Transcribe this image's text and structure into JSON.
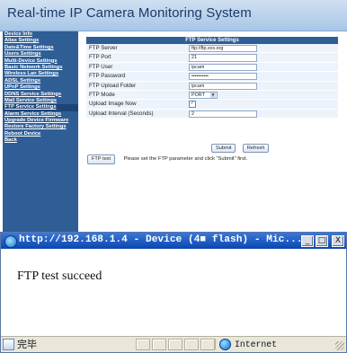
{
  "page": {
    "title": "Real-time IP Camera Monitoring System"
  },
  "sidebar": {
    "items": [
      "Device Info",
      "Alias Settings",
      "Date&Time Settings",
      "Users Settings",
      "Multi-Device Settings",
      "Basic Network Settings",
      "Wireless Lan Settings",
      "ADSL Settings",
      "UPnP Settings",
      "DDNS Service Settings",
      "Mail Service Settings",
      "FTP Service Settings",
      "Alarm Service Settings",
      "Upgrade Device Firmware",
      "Restore Factory Settings",
      "Reboot Device",
      "Back"
    ],
    "active": "FTP Service Settings"
  },
  "ftp": {
    "title": "FTP Service Settings",
    "server_label": "FTP Server",
    "server_value": "ftp://ftp.xxx.org",
    "port_label": "FTP Port",
    "port_value": "21",
    "user_label": "FTP User",
    "user_value": "ipcam",
    "password_label": "FTP Password",
    "password_value": "••••••••••",
    "folder_label": "FTP Upload Folder",
    "folder_value": "ipcam",
    "mode_label": "FTP Mode",
    "mode_value": "PORT",
    "upload_now_label": "Upload Image Now",
    "upload_now_checked": "✓",
    "interval_label": "Upload Interval (Seconds)",
    "interval_value": "2",
    "submit_label": "Submit",
    "refresh_label": "Refresh",
    "test_label": "FTP test",
    "test_hint": "Please set the FTP parameter and click \"Submit\" first."
  },
  "popup": {
    "title": "http://192.168.1.4 - Device (4■ flash) - Mic...",
    "message": "FTP test succeed",
    "status_done": "完毕",
    "zone": "Internet",
    "minimize": "_",
    "maximize": "□",
    "close": "X"
  },
  "colors": {
    "sidebar_bg": "#2f5e96",
    "title_bar": "#2f5e96",
    "popup_titlebar": "#0b46b0"
  }
}
